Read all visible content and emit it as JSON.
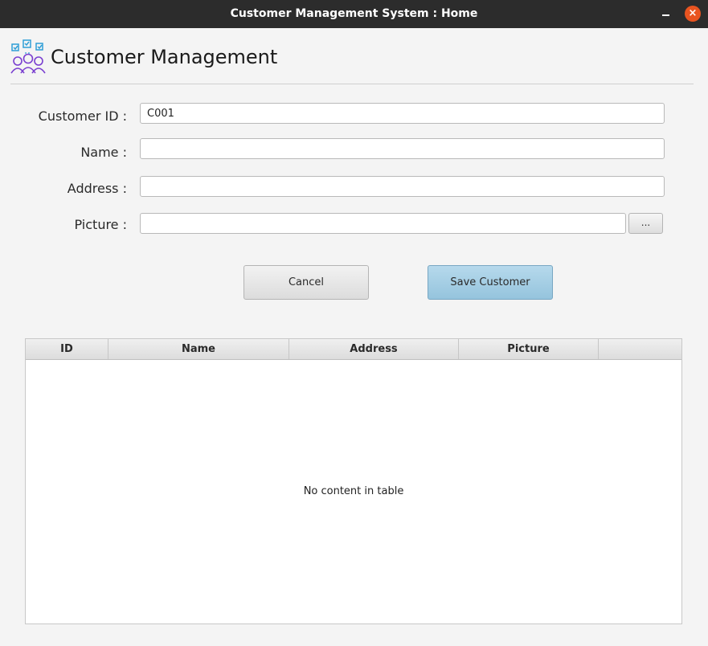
{
  "window": {
    "title": "Customer Management System : Home"
  },
  "header": {
    "title": "Customer Management"
  },
  "form": {
    "customer_id": {
      "label": "Customer ID :",
      "value": "C001"
    },
    "name": {
      "label": "Name :",
      "value": ""
    },
    "address": {
      "label": "Address :",
      "value": ""
    },
    "picture": {
      "label": "Picture :",
      "value": "",
      "browse_label": "..."
    }
  },
  "buttons": {
    "cancel": "Cancel",
    "save": "Save Customer"
  },
  "table": {
    "columns": [
      "ID",
      "Name",
      "Address",
      "Picture",
      ""
    ],
    "placeholder": "No content in table"
  },
  "colors": {
    "accent": "#a7cfe6",
    "close": "#e95420",
    "titlebar": "#2c2c2c"
  }
}
